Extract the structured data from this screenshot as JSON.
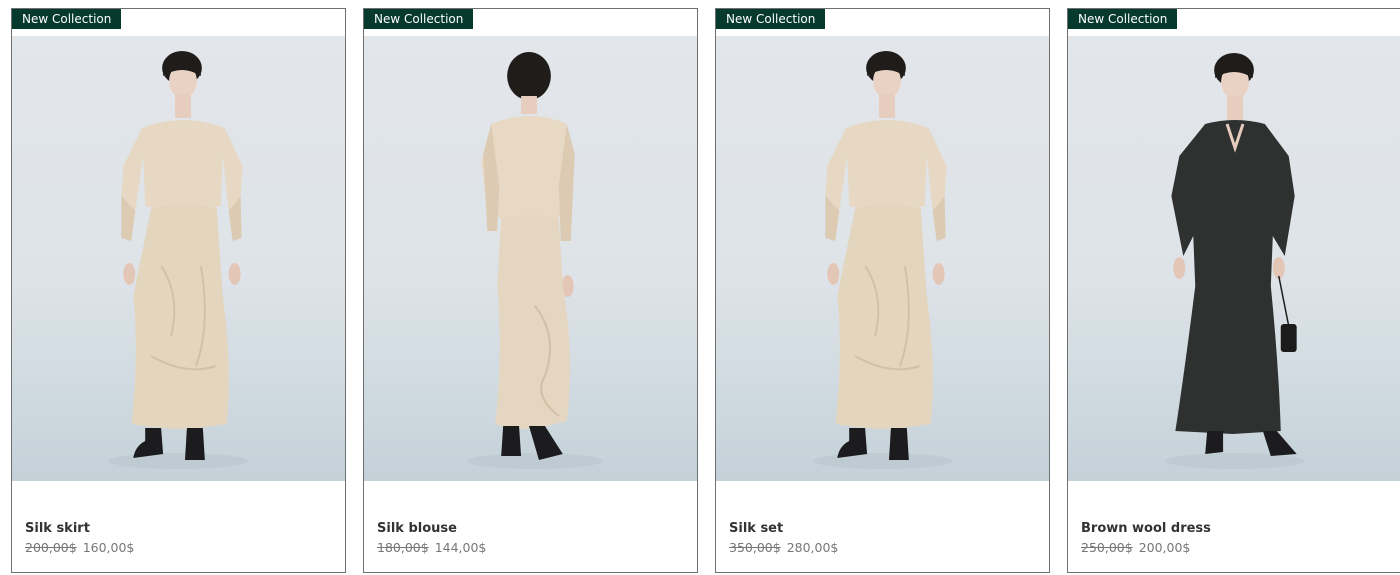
{
  "products": [
    {
      "badge": "New Collection",
      "name": "Silk skirt",
      "old_price": "200,00$",
      "price": "160,00$",
      "image": "model-front-cream-silk-set"
    },
    {
      "badge": "New Collection",
      "name": "Silk blouse",
      "old_price": "180,00$",
      "price": "144,00$",
      "image": "model-back-cream-silk-set"
    },
    {
      "badge": "New Collection",
      "name": "Silk set",
      "old_price": "350,00$",
      "price": "280,00$",
      "image": "model-front-cream-silk-set"
    },
    {
      "badge": "New Collection",
      "name": "Brown wool dress",
      "old_price": "250,00$",
      "price": "200,00$",
      "image": "model-front-dark-wool-dress"
    }
  ],
  "colors": {
    "badge_bg": "#053a2c",
    "card_border": "#6f6f6f",
    "cream": "#e6d8c3",
    "dark_dress": "#2f3130"
  }
}
